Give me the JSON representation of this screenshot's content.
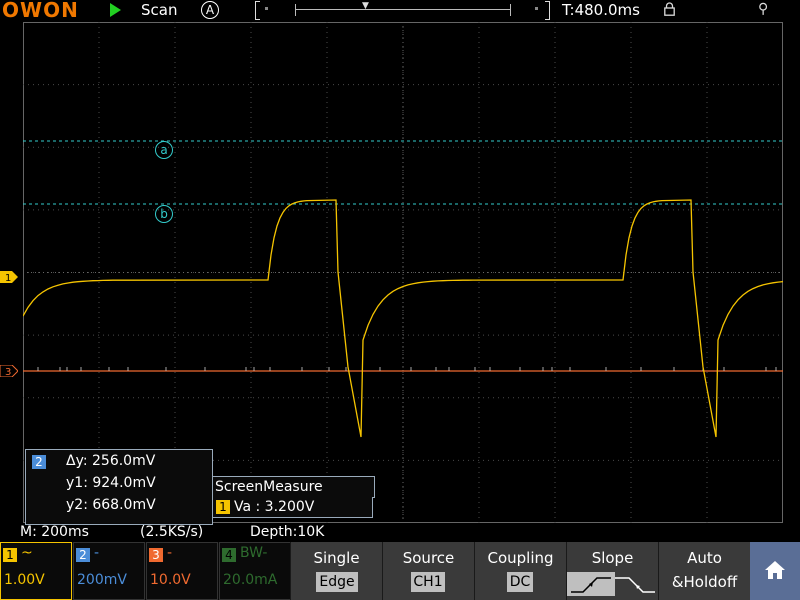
{
  "topbar": {
    "logo": "OWON",
    "run_state": "Scan",
    "acq_mode": "A",
    "time_pos": "T:480.0ms"
  },
  "cursors": {
    "a": "a",
    "b": "b",
    "color": "#33cccc"
  },
  "cursor_box": {
    "channel": "2",
    "dy": "Δy: 256.0mV",
    "y1": "y1: 924.0mV",
    "y2": "y2: 668.0mV"
  },
  "screen_measure": {
    "title": "ScreenMeasure",
    "channel": "1",
    "value": "Va : 3.200V"
  },
  "status": {
    "timebase": "M: 200ms",
    "sample_rate": "(2.5KS/s)",
    "depth": "Depth:10K"
  },
  "channels": [
    {
      "num": "1",
      "coupling": "~",
      "scale": "1.00V",
      "color": "#f5c400"
    },
    {
      "num": "2",
      "coupling": "-",
      "scale": "200mV",
      "color": "#4b8dd8"
    },
    {
      "num": "3",
      "coupling": "-",
      "scale": "10.0V",
      "color": "#f06a30"
    },
    {
      "num": "4",
      "coupling": "BW-",
      "scale": "20.0mA",
      "color": "#2e6b2e"
    }
  ],
  "menu": {
    "trigger_type": {
      "title": "Single",
      "value": "Edge"
    },
    "source": {
      "title": "Source",
      "value": "CH1"
    },
    "coupling": {
      "title": "Coupling",
      "value": "DC"
    },
    "slope": {
      "title": "Slope"
    },
    "holdoff": {
      "title": "Auto",
      "value": "&Holdoff"
    }
  },
  "colors": {
    "ch1": "#f5c400",
    "ch3": "#f06a30",
    "grid": "#555555",
    "menu_bg": "#3a3a3a",
    "home_bg": "#5a6e96"
  },
  "icons": {
    "play": "play-icon",
    "lock": "lock-icon",
    "usb": "usb-icon",
    "home": "home-icon"
  }
}
